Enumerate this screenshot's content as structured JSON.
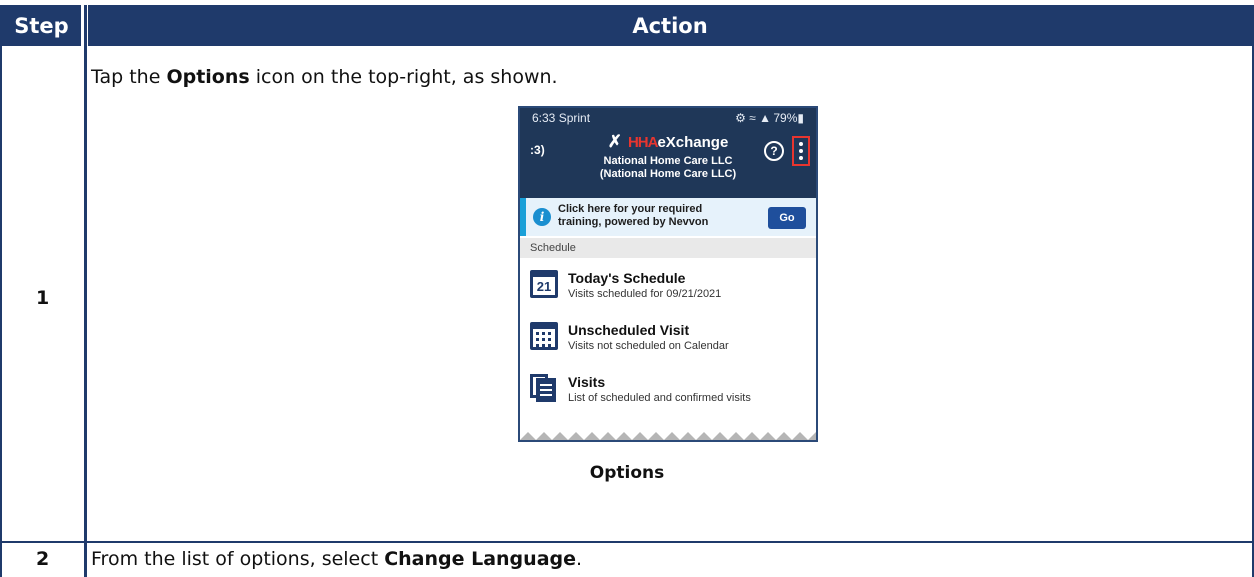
{
  "table": {
    "headers": {
      "step": "Step",
      "action": "Action"
    },
    "rows": [
      {
        "step": "1",
        "instruction_pre": "Tap the ",
        "instruction_bold": "Options",
        "instruction_post": " icon on the top-right, as shown.",
        "caption": "Options"
      },
      {
        "step": "2",
        "instruction_pre": "From the list of options, select ",
        "instruction_bold": "Change Language",
        "instruction_post": "."
      }
    ]
  },
  "phone": {
    "status_left": "6:33 Sprint",
    "status_right": "79%",
    "brand_hha": "HHA",
    "brand_rest": "eXchange",
    "agency_line1": "National Home Care LLC",
    "agency_line2": "(National Home Care LLC)",
    "badge": "3",
    "help_icon": "?",
    "banner_line1": "Click here for your required",
    "banner_line2": "training, powered by Nevvon",
    "banner_button": "Go",
    "section_label": "Schedule",
    "items": [
      {
        "title": "Today's Schedule",
        "subtitle": "Visits scheduled for 09/21/2021",
        "icon_text": "21",
        "icon": "calendar-day-icon"
      },
      {
        "title": "Unscheduled Visit",
        "subtitle": "Visits not scheduled on Calendar",
        "icon": "calendar-grid-icon"
      },
      {
        "title": "Visits",
        "subtitle": "List of scheduled and confirmed visits",
        "icon": "visits-list-icon"
      }
    ],
    "colors": {
      "header_bg": "#1f3758",
      "accent_red": "#e8352f",
      "table_header": "#1f3a6b",
      "banner_stripe": "#1aa0d8"
    }
  }
}
